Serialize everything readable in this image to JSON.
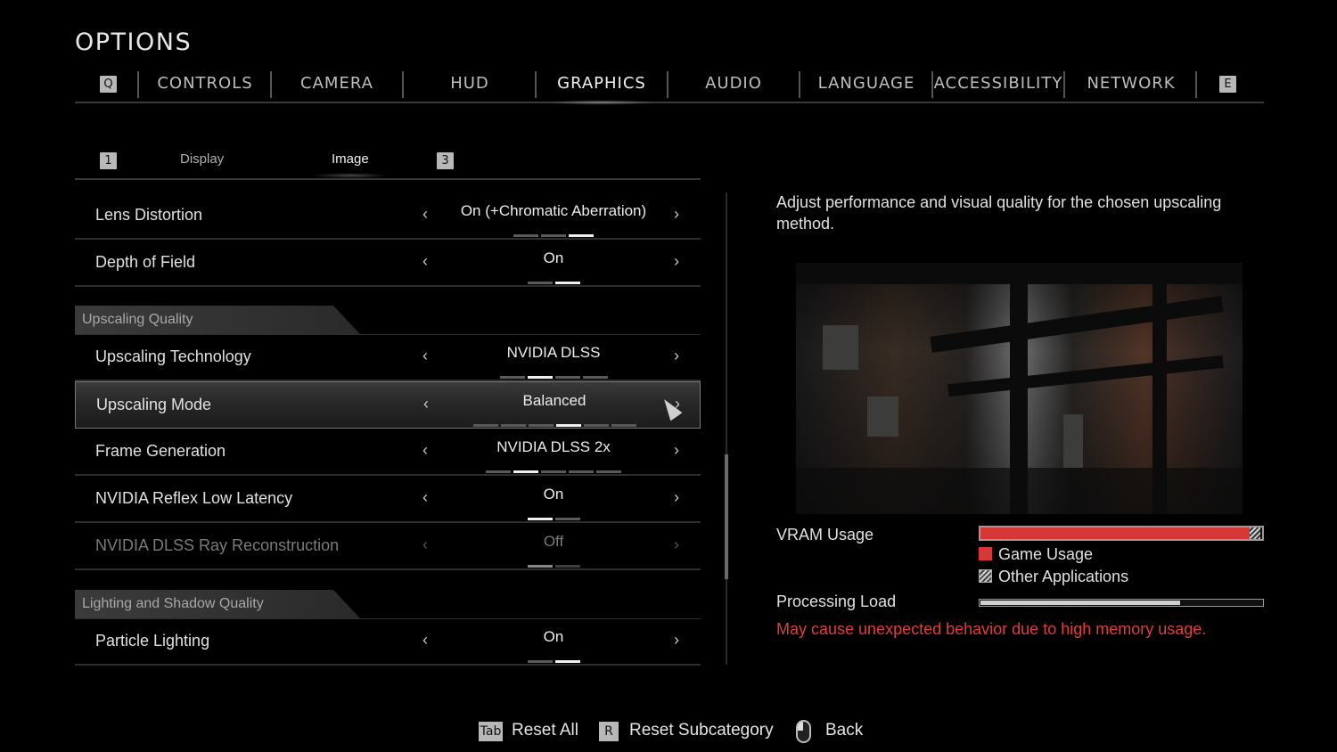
{
  "page_title": "OPTIONS",
  "top_tabs": {
    "prev_key": "Q",
    "next_key": "E",
    "items": [
      {
        "label": "CONTROLS"
      },
      {
        "label": "CAMERA"
      },
      {
        "label": "HUD"
      },
      {
        "label": "GRAPHICS",
        "active": true
      },
      {
        "label": "AUDIO"
      },
      {
        "label": "LANGUAGE"
      },
      {
        "label": "ACCESSIBILITY"
      },
      {
        "label": "NETWORK"
      }
    ]
  },
  "sub_tabs": {
    "prev_key": "1",
    "next_key": "3",
    "items": [
      {
        "label": "Display"
      },
      {
        "label": "Image",
        "active": true
      }
    ]
  },
  "settings": {
    "lens_distortion": {
      "label": "Lens Distortion",
      "value": "On (+Chromatic Aberration)",
      "options": 3,
      "selected": 3
    },
    "depth_of_field": {
      "label": "Depth of Field",
      "value": "On",
      "options": 2,
      "selected": 2
    },
    "section_upscaling": "Upscaling Quality",
    "upscaling_technology": {
      "label": "Upscaling Technology",
      "value": "NVIDIA DLSS",
      "options": 4,
      "selected": 2
    },
    "upscaling_mode": {
      "label": "Upscaling Mode",
      "value": "Balanced",
      "options": 6,
      "selected": 4
    },
    "frame_generation": {
      "label": "Frame Generation",
      "value": "NVIDIA DLSS 2x",
      "options": 5,
      "selected": 2
    },
    "reflex": {
      "label": "NVIDIA Reflex Low Latency",
      "value": "On",
      "options": 2,
      "selected": 1
    },
    "ray_reconstruction": {
      "label": "NVIDIA DLSS Ray Reconstruction",
      "value": "Off",
      "options": 2,
      "selected": 1,
      "disabled": true
    },
    "section_lighting": "Lighting and Shadow Quality",
    "particle_lighting": {
      "label": "Particle Lighting",
      "value": "On",
      "options": 2,
      "selected": 2
    }
  },
  "arrows": {
    "left": "‹",
    "right": "›"
  },
  "right_panel": {
    "description": "Adjust performance and visual quality for the chosen upscaling method.",
    "vram": {
      "label": "VRAM Usage",
      "game_fraction": 0.955,
      "other_fraction": 0.04,
      "legend_game": "Game Usage",
      "legend_other": "Other Applications",
      "game_color": "#d63838"
    },
    "processing": {
      "label": "Processing Load",
      "fraction": 0.71
    },
    "warning": "May cause unexpected behavior due to high memory usage.",
    "warning_color": "#e23c3c"
  },
  "footer": {
    "reset_all_key": "Tab",
    "reset_all": "Reset All",
    "reset_sub_key": "R",
    "reset_sub": "Reset Subcategory",
    "back_icon": "mouse-icon",
    "back": "Back"
  }
}
